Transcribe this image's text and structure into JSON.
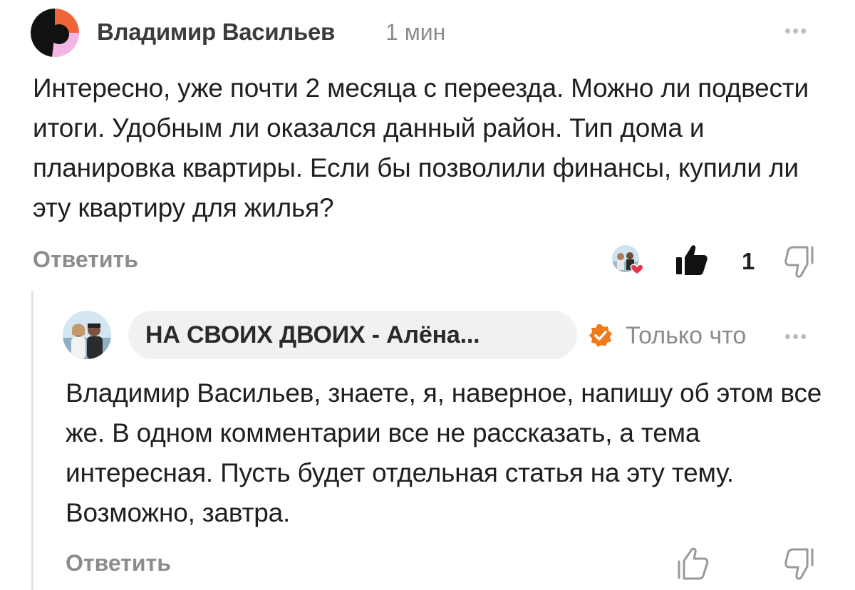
{
  "comment": {
    "author": "Владимир Васильев",
    "time": "1 мин",
    "text": "Интересно, уже почти 2 месяца с переезда. Можно ли подвести итоги. Удобным ли оказался данный район. Тип дома и планировка квартиры. Если бы позволили финансы, купили ли эту квартиру для жилья?",
    "reply_label": "Ответить",
    "likes": "1",
    "more_label": "•••"
  },
  "reply": {
    "author": "НА СВОИХ ДВОИХ - Алёна...",
    "time": "Только что",
    "text": "Владимир Васильев, знаете, я, наверное, напишу об этом все же. В одном комментарии все не рассказать, а тема интересная. Пусть будет отдельная статья на эту тему. Возможно, завтра.",
    "reply_label": "Ответить",
    "more_label": "•••"
  },
  "colors": {
    "verified_badge": "#f07a1a",
    "heart": "#e8334a",
    "avatar_orange": "#f0643a",
    "avatar_pink": "#f3b6e2"
  },
  "icons": [
    "author-avatar-icon",
    "more-options-icon",
    "liked-by-author-avatar",
    "heart-icon",
    "thumbs-up-filled-icon",
    "thumbs-down-icon",
    "thumbs-up-outline-icon",
    "verified-badge-icon"
  ]
}
